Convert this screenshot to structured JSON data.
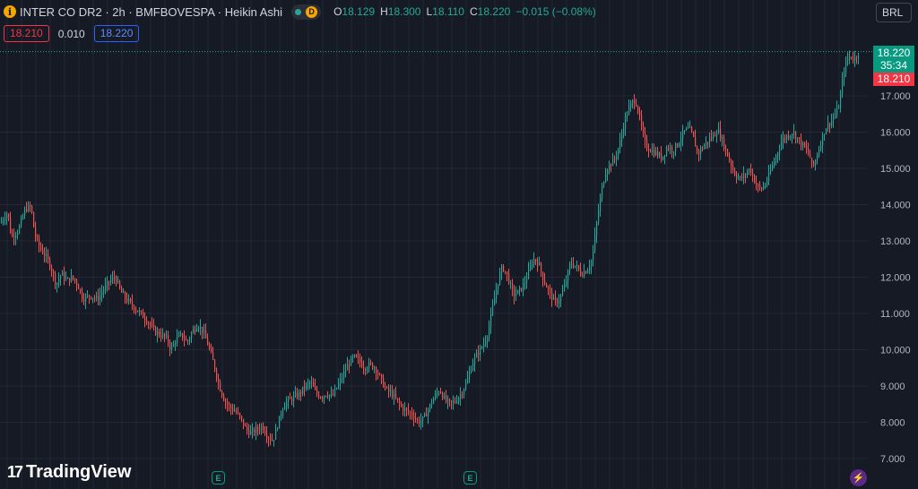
{
  "header": {
    "info_icon": "i",
    "title": "INTER CO DR2 · 2h · BMFBOVESPA · Heikin Ashi",
    "market_status_icon": "green-dot-icon",
    "d_badge": "D",
    "ohlc": {
      "o_key": "O",
      "o": "18.129",
      "h_key": "H",
      "h": "18.300",
      "l_key": "L",
      "l": "18.110",
      "c_key": "C",
      "c": "18.220",
      "change": "−0.015 (−0.08%)"
    }
  },
  "trade_prices": {
    "sell": "18.210",
    "spread": "0.010",
    "buy": "18.220"
  },
  "currency": "BRL",
  "last_price_label": {
    "price": "18.220",
    "countdown": "35:34"
  },
  "bid_price_label": "18.210",
  "logo": {
    "mark": "17",
    "text": "TradingView"
  },
  "event_marks": [
    "E",
    "E"
  ],
  "bolt_icon": "⚡",
  "colors": {
    "background": "#161a25",
    "up": "#26a69a",
    "down": "#ef5350",
    "grid": "#232733",
    "axis_text": "#b2b5be"
  },
  "chart_data": {
    "type": "candlestick",
    "style": "Heikin Ashi",
    "ylim": [
      6.75,
      17.3
    ],
    "y_ticks": [
      "17.000",
      "16.000",
      "15.000",
      "14.000",
      "13.000",
      "12.000",
      "11.000",
      "10.000",
      "9.000",
      "8.000",
      "7.000"
    ],
    "y_tick_values": [
      17,
      16,
      15,
      14,
      13,
      12,
      11,
      10,
      9,
      8,
      7
    ],
    "grid": true,
    "last_price_line": 18.22,
    "close_path": [
      [
        0,
        13.5
      ],
      [
        8,
        13.8
      ],
      [
        12,
        13.1
      ],
      [
        20,
        13.3
      ],
      [
        28,
        13.9
      ],
      [
        34,
        13.95
      ],
      [
        38,
        13.2
      ],
      [
        44,
        12.8
      ],
      [
        50,
        12.6
      ],
      [
        56,
        12.3
      ],
      [
        62,
        11.8
      ],
      [
        68,
        12.1
      ],
      [
        74,
        11.9
      ],
      [
        80,
        12.0
      ],
      [
        86,
        11.8
      ],
      [
        92,
        11.4
      ],
      [
        100,
        11.5
      ],
      [
        108,
        11.4
      ],
      [
        116,
        11.7
      ],
      [
        122,
        11.9
      ],
      [
        128,
        12.0
      ],
      [
        134,
        11.6
      ],
      [
        140,
        11.4
      ],
      [
        148,
        11.2
      ],
      [
        156,
        11.0
      ],
      [
        164,
        10.8
      ],
      [
        172,
        10.5
      ],
      [
        180,
        10.4
      ],
      [
        186,
        10.3
      ],
      [
        190,
        10.0
      ],
      [
        196,
        10.3
      ],
      [
        202,
        10.4
      ],
      [
        208,
        10.2
      ],
      [
        214,
        10.5
      ],
      [
        220,
        10.7
      ],
      [
        226,
        10.5
      ],
      [
        232,
        10.1
      ],
      [
        238,
        9.6
      ],
      [
        244,
        9.0
      ],
      [
        250,
        8.6
      ],
      [
        256,
        8.4
      ],
      [
        262,
        8.3
      ],
      [
        268,
        8.1
      ],
      [
        274,
        7.8
      ],
      [
        280,
        7.7
      ],
      [
        286,
        7.8
      ],
      [
        292,
        7.9
      ],
      [
        298,
        7.6
      ],
      [
        304,
        7.5
      ],
      [
        310,
        8.0
      ],
      [
        316,
        8.5
      ],
      [
        322,
        8.6
      ],
      [
        328,
        8.7
      ],
      [
        334,
        8.8
      ],
      [
        340,
        9.0
      ],
      [
        346,
        9.1
      ],
      [
        352,
        8.8
      ],
      [
        358,
        8.7
      ],
      [
        364,
        8.8
      ],
      [
        370,
        8.7
      ],
      [
        376,
        9.0
      ],
      [
        382,
        9.3
      ],
      [
        388,
        9.6
      ],
      [
        394,
        9.8
      ],
      [
        400,
        9.7
      ],
      [
        406,
        9.5
      ],
      [
        412,
        9.6
      ],
      [
        418,
        9.5
      ],
      [
        424,
        9.2
      ],
      [
        430,
        8.9
      ],
      [
        436,
        8.8
      ],
      [
        442,
        8.6
      ],
      [
        448,
        8.4
      ],
      [
        454,
        8.3
      ],
      [
        460,
        8.2
      ],
      [
        466,
        8.0
      ],
      [
        472,
        8.1
      ],
      [
        478,
        8.4
      ],
      [
        484,
        8.7
      ],
      [
        490,
        8.9
      ],
      [
        496,
        8.6
      ],
      [
        502,
        8.5
      ],
      [
        508,
        8.6
      ],
      [
        514,
        8.8
      ],
      [
        520,
        9.1
      ],
      [
        526,
        9.6
      ],
      [
        532,
        9.9
      ],
      [
        538,
        10.1
      ],
      [
        544,
        10.5
      ],
      [
        550,
        11.3
      ],
      [
        556,
        12.0
      ],
      [
        560,
        12.3
      ],
      [
        566,
        12.0
      ],
      [
        572,
        11.5
      ],
      [
        578,
        11.6
      ],
      [
        584,
        11.8
      ],
      [
        590,
        12.2
      ],
      [
        594,
        12.5
      ],
      [
        600,
        12.4
      ],
      [
        606,
        11.9
      ],
      [
        612,
        11.6
      ],
      [
        618,
        11.3
      ],
      [
        624,
        11.4
      ],
      [
        630,
        11.8
      ],
      [
        636,
        12.4
      ],
      [
        642,
        12.3
      ],
      [
        648,
        12.1
      ],
      [
        654,
        12.2
      ],
      [
        660,
        12.5
      ],
      [
        664,
        13.3
      ],
      [
        668,
        14.0
      ],
      [
        672,
        14.6
      ],
      [
        676,
        15.0
      ],
      [
        680,
        15.1
      ],
      [
        686,
        15.3
      ],
      [
        692,
        15.8
      ],
      [
        696,
        16.3
      ],
      [
        700,
        16.6
      ],
      [
        704,
        16.8
      ],
      [
        708,
        16.9
      ],
      [
        712,
        16.5
      ],
      [
        716,
        16.0
      ],
      [
        720,
        15.6
      ],
      [
        726,
        15.5
      ],
      [
        732,
        15.4
      ],
      [
        738,
        15.3
      ],
      [
        744,
        15.6
      ],
      [
        750,
        15.5
      ],
      [
        756,
        15.7
      ],
      [
        762,
        16.0
      ],
      [
        768,
        16.1
      ],
      [
        772,
        15.9
      ],
      [
        778,
        15.4
      ],
      [
        784,
        15.6
      ],
      [
        790,
        15.8
      ],
      [
        796,
        15.9
      ],
      [
        800,
        16.1
      ],
      [
        806,
        15.7
      ],
      [
        812,
        15.3
      ],
      [
        818,
        14.9
      ],
      [
        824,
        14.7
      ],
      [
        830,
        14.8
      ],
      [
        836,
        15.0
      ],
      [
        842,
        14.6
      ],
      [
        848,
        14.4
      ],
      [
        854,
        14.6
      ],
      [
        860,
        15.0
      ],
      [
        866,
        15.4
      ],
      [
        872,
        15.8
      ],
      [
        878,
        15.9
      ],
      [
        884,
        16.0
      ],
      [
        890,
        15.8
      ],
      [
        896,
        15.6
      ],
      [
        902,
        15.4
      ],
      [
        906,
        15.0
      ],
      [
        910,
        15.3
      ],
      [
        916,
        15.8
      ],
      [
        920,
        16.1
      ],
      [
        926,
        16.3
      ],
      [
        932,
        16.5
      ],
      [
        936,
        16.8
      ],
      [
        940,
        17.6
      ],
      [
        944,
        18.0
      ],
      [
        948,
        18.1
      ],
      [
        952,
        18.0
      ],
      [
        956,
        18.15
      ],
      [
        960,
        18.22
      ]
    ]
  }
}
